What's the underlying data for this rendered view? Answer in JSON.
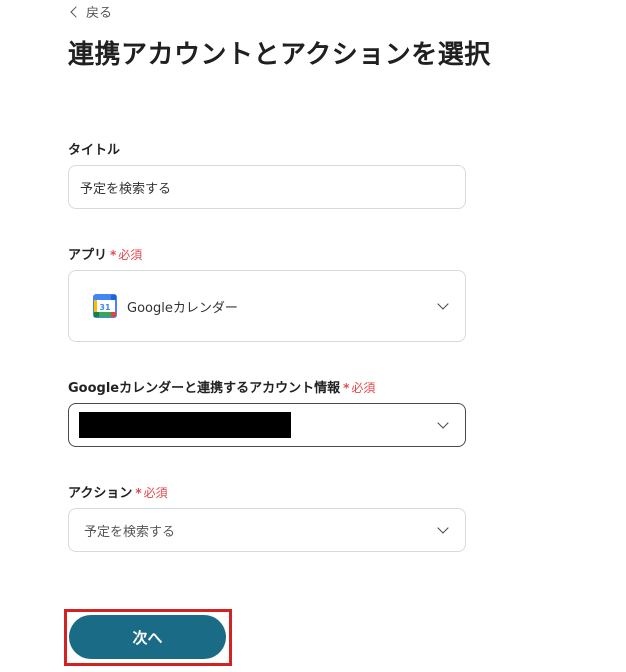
{
  "back": {
    "label": "戻る"
  },
  "page": {
    "title": "連携アカウントとアクションを選択"
  },
  "required_label": "必須",
  "fields": {
    "title": {
      "label": "タイトル",
      "value": "予定を検索する"
    },
    "app": {
      "label": "アプリ",
      "value": "Googleカレンダー",
      "icon_day": "31"
    },
    "account": {
      "label": "Googleカレンダーと連携するアカウント情報"
    },
    "action": {
      "label": "アクション",
      "value": "予定を検索する"
    }
  },
  "next_button": {
    "label": "次へ",
    "color": "#1a6b86"
  },
  "colors": {
    "required": "#e5484d",
    "highlight_border": "#d32222"
  }
}
